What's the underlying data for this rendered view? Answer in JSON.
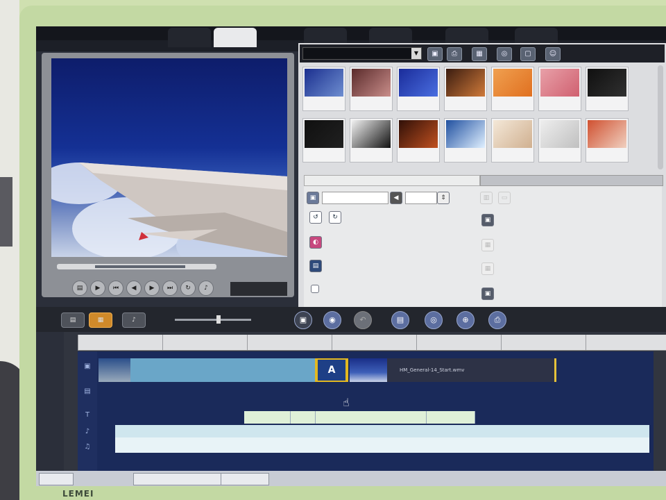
{
  "colors": {
    "bezel": "#c3d9a3",
    "app_dark": "#23262d",
    "timeline_track": "#1a2a5a",
    "accent_orange": "#d08a2a",
    "title_clip_yellow": "#e3b820"
  },
  "monitor": {
    "brand": "LEMEI"
  },
  "app": {
    "titlebar": "",
    "menu": [
      "",
      ""
    ]
  },
  "step_tabs": [
    {
      "label": "",
      "active": false
    },
    {
      "label": "",
      "active": true
    },
    {
      "label": "",
      "active": false
    },
    {
      "label": "",
      "active": false
    },
    {
      "label": "",
      "active": false
    },
    {
      "label": "",
      "active": false
    }
  ],
  "preview": {
    "timecode": ""
  },
  "library": {
    "folder_select": "",
    "icons": [
      "folder-icon",
      "import-icon",
      "film-icon",
      "audio-icon",
      "window-icon",
      "person-icon"
    ],
    "thumbnails": [
      {
        "colors": [
          "#1b2f8f",
          "#6e8ed0"
        ],
        "caption": ""
      },
      {
        "colors": [
          "#5a2b2b",
          "#c98d8a"
        ],
        "caption": ""
      },
      {
        "colors": [
          "#1a2c9a",
          "#4a6ee0"
        ],
        "caption": ""
      },
      {
        "colors": [
          "#3a1c10",
          "#d07a3a"
        ],
        "caption": ""
      },
      {
        "colors": [
          "#f0a050",
          "#e07020"
        ],
        "caption": ""
      },
      {
        "colors": [
          "#e8a0a8",
          "#d06070"
        ],
        "caption": ""
      },
      {
        "colors": [
          "#101010",
          "#303030"
        ],
        "caption": ""
      },
      {
        "colors": [
          "#101010",
          "#202020"
        ],
        "caption": ""
      },
      {
        "colors": [
          "#f2f2f2",
          "#111111"
        ],
        "caption": ""
      },
      {
        "colors": [
          "#301008",
          "#c05020"
        ],
        "caption": ""
      },
      {
        "colors": [
          "#2050a0",
          "#e0f0ff"
        ],
        "caption": ""
      },
      {
        "colors": [
          "#f4e8d8",
          "#d0b090"
        ],
        "caption": ""
      },
      {
        "colors": [
          "#eeeeee",
          "#c0c0c0"
        ],
        "caption": ""
      },
      {
        "colors": [
          "#d05030",
          "#f0d0c0"
        ],
        "caption": ""
      }
    ]
  },
  "options": {
    "tab_left": "",
    "tab_right": "",
    "duration_field": "",
    "labels_left": [
      "",
      "",
      ""
    ],
    "checkbox_label": "",
    "labels_right": [
      "",
      "",
      "",
      ""
    ]
  },
  "timeline": {
    "ruler_labels": [
      "",
      "",
      "",
      "",
      "",
      "",
      ""
    ],
    "clip_blue_label": "",
    "title_clip_letter": "A",
    "clip_dark_label": "HM_General-14_Start.wmv",
    "subclips": [
      "",
      "",
      "",
      ""
    ],
    "audio_label": ""
  },
  "taskbar": {
    "items": [
      "",
      ""
    ]
  }
}
